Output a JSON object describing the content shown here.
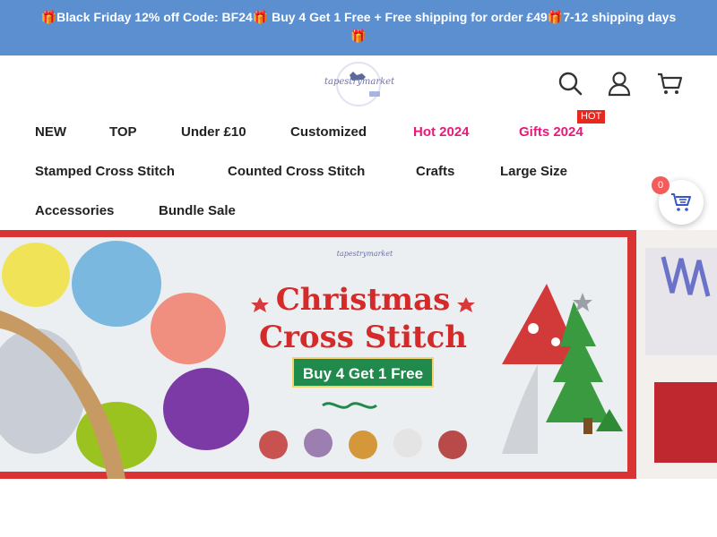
{
  "announcement": {
    "text": "🎁Black Friday 12% off Code: BF24🎁 Buy 4 Get 1 Free + Free shipping for order £49🎁7-12 shipping days🎁"
  },
  "header": {
    "logo_text": "tapestrymarket",
    "icons": [
      "search-icon",
      "account-icon",
      "cart-icon"
    ]
  },
  "nav": {
    "row1": [
      "NEW",
      "TOP",
      "Under £10",
      "Customized",
      "Hot 2024",
      "Gifts 2024"
    ],
    "row2": [
      "Stamped Cross Stitch",
      "Counted Cross Stitch",
      "Crafts",
      "Large Size"
    ],
    "row3": [
      "Accessories",
      "Bundle Sale"
    ],
    "hot_badge": "HOT",
    "highlight_color": "#e8197a"
  },
  "floating_cart": {
    "count": "0"
  },
  "banner": {
    "logo_text": "tapestrymarket",
    "title_line1": "Christmas",
    "title_line2": "Cross Stitch",
    "cta": "Buy 4 Get 1 Free"
  },
  "colors": {
    "announce_bg": "#5b8fd0",
    "accent_pink": "#e8197a",
    "badge_red": "#e8271f",
    "banner_red": "#d42a2a",
    "banner_green": "#1f8a4c"
  }
}
